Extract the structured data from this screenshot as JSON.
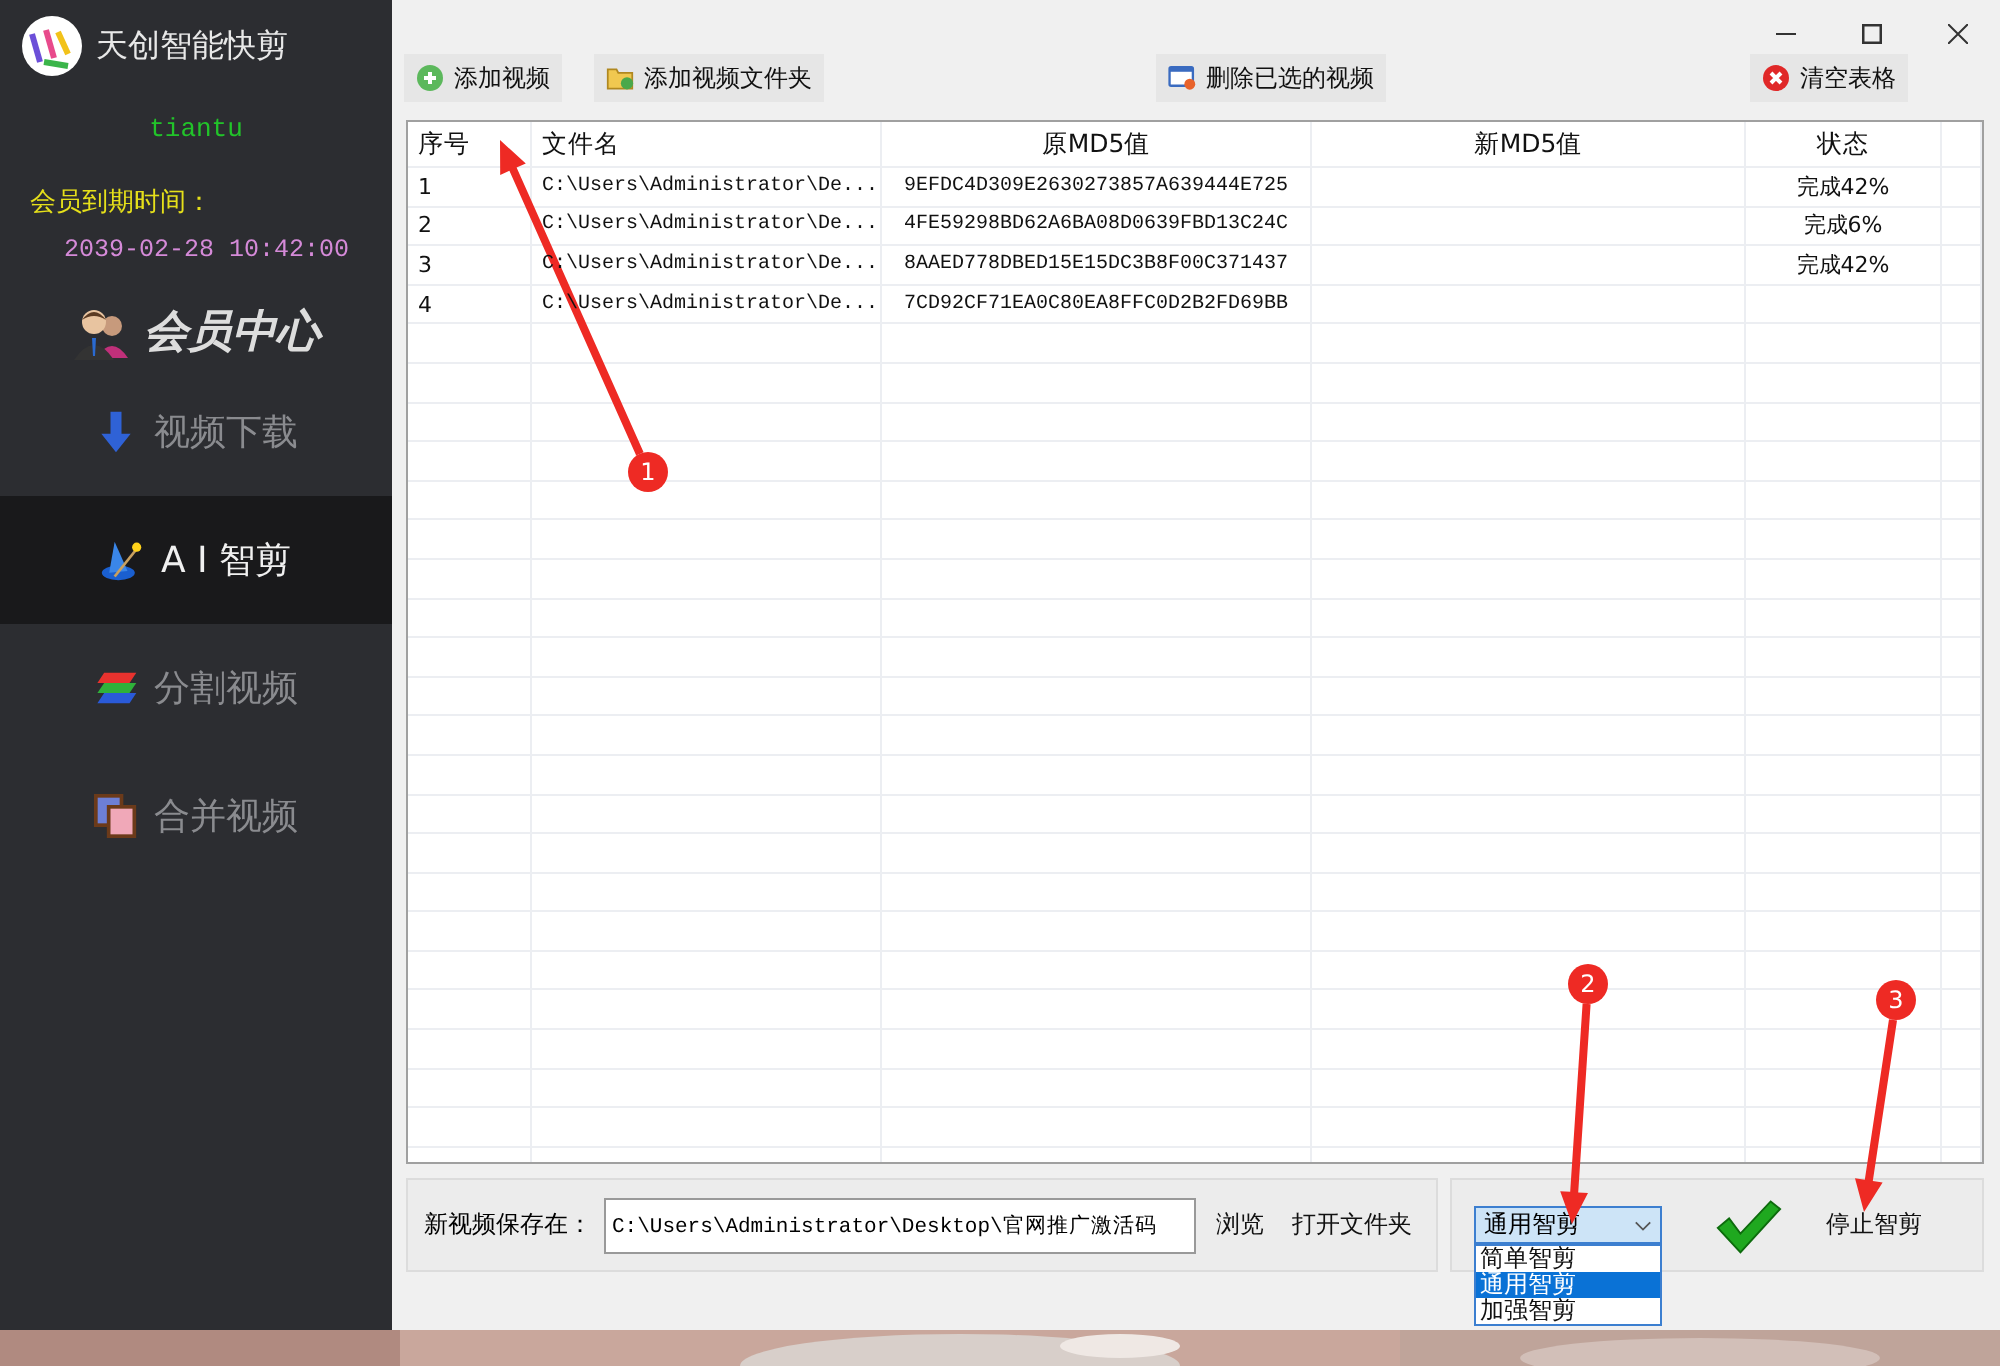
{
  "app": {
    "title": "天创智能快剪",
    "username": "tiantu",
    "expiry_label": "会员到期时间：",
    "expiry_date": "2039-02-28 10:42:00",
    "member_center": "会员中心"
  },
  "nav": [
    {
      "label": "视频下载",
      "kind": "download",
      "selected": false
    },
    {
      "label": "A I 智剪",
      "kind": "wand",
      "selected": true
    },
    {
      "label": "分割视频",
      "kind": "split",
      "selected": false
    },
    {
      "label": "合并视频",
      "kind": "merge",
      "selected": false
    }
  ],
  "toolbar": [
    {
      "label": "添加视频",
      "kind": "add"
    },
    {
      "label": "添加视频文件夹",
      "kind": "folder"
    },
    {
      "label": "删除已选的视频",
      "kind": "delete"
    },
    {
      "label": "清空表格",
      "kind": "clear"
    }
  ],
  "table": {
    "columns": [
      "序号",
      "文件名",
      "原MD5值",
      "新MD5值",
      "状态"
    ],
    "rows": [
      [
        "1",
        "C:\\Users\\Administrator\\De...",
        "9EFDC4D309E2630273857A639444E725",
        "",
        "完成42%"
      ],
      [
        "2",
        "C:\\Users\\Administrator\\De...",
        "4FE59298BD62A6BA08D0639FBD13C24C",
        "",
        "完成6%"
      ],
      [
        "3",
        "C:\\Users\\Administrator\\De...",
        "8AAED778DBED15E15DC3B8F00C371437",
        "",
        "完成42%"
      ],
      [
        "4",
        "C:\\Users\\Administrator\\De...",
        "7CD92CF71EA0C80EA8FFC0D2B2FD69BB",
        "",
        ""
      ]
    ]
  },
  "save": {
    "label": "新视频保存在：",
    "value": "C:\\Users\\Administrator\\Desktop\\官网推广激活码",
    "browse": "浏览",
    "open_folder": "打开文件夹"
  },
  "mode": {
    "value": "通用智剪",
    "options": [
      {
        "label": "简单智剪",
        "selected": false
      },
      {
        "label": "通用智剪",
        "selected": true
      },
      {
        "label": "加强智剪",
        "selected": false
      }
    ]
  },
  "stop_button": "停止智剪",
  "annotations": [
    "1",
    "2",
    "3"
  ]
}
